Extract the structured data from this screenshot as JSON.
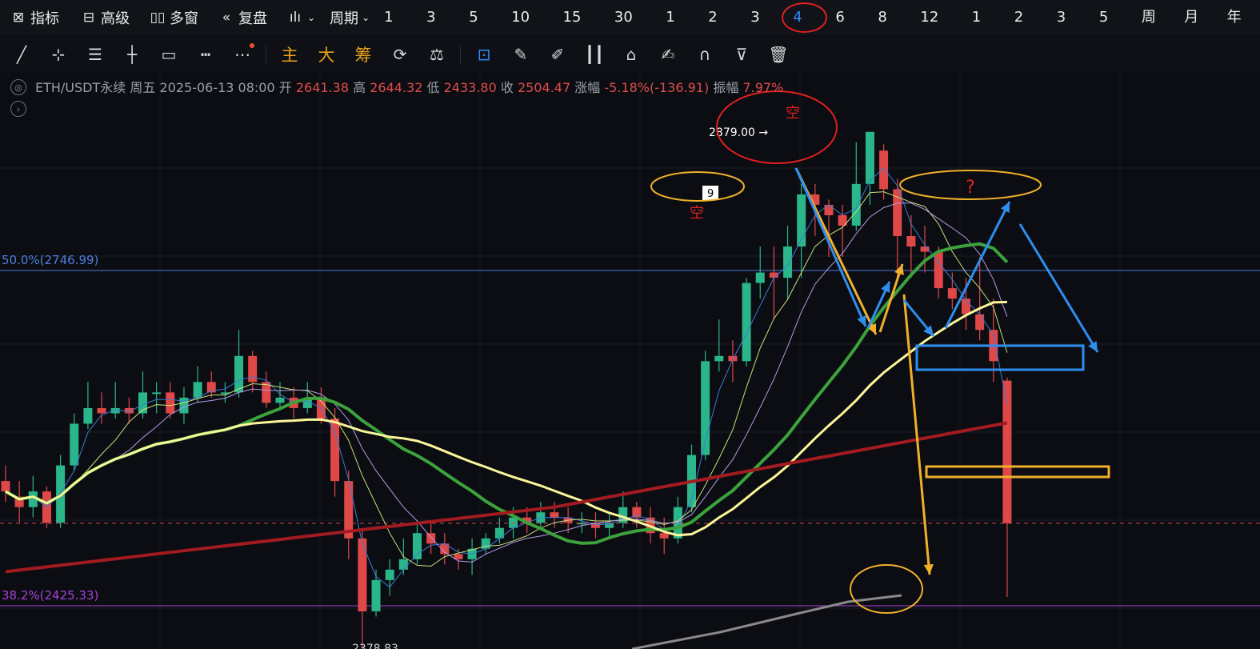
{
  "toolbar": {
    "indicators": "指标",
    "advanced": "高级",
    "multiwindow": "多窗",
    "replay": "复盘",
    "period_menu": "周期",
    "periods": [
      "1分",
      "3分",
      "5分",
      "10分",
      "15分",
      "30分",
      "1时",
      "2时",
      "3时",
      "4时",
      "6时",
      "8时",
      "12时",
      "1日",
      "2日",
      "3日",
      "5日",
      "周K",
      "月K",
      "年K"
    ],
    "active_period": "4时"
  },
  "drawtools": {
    "main": "主",
    "large": "大",
    "chips": "筹"
  },
  "info": {
    "symbol": "ETH/USDT永续",
    "weekday": "周五",
    "datetime": "2025-06-13 08:00",
    "open_label": "开",
    "open": "2641.38",
    "high_label": "高",
    "high": "2644.32",
    "low_label": "低",
    "low": "2433.80",
    "close_label": "收",
    "close": "2504.47",
    "change_label": "涨幅",
    "change": "-5.18%(-136.91)",
    "amp_label": "振幅",
    "amp": "7.97%"
  },
  "chart_data": {
    "type": "candlestick",
    "fib_levels": [
      {
        "label": "50.0%(2746.99)",
        "value": 2746.99,
        "color": "#4f7ddb"
      },
      {
        "label": "38.2%(2425.33)",
        "value": 2425.33,
        "color": "#a742d8"
      }
    ],
    "high_marker": "2879.00",
    "low_marker_partial": "2378.83",
    "annotations": {
      "short_1": "空",
      "short_2": "空",
      "question": "?",
      "td_count": "9"
    },
    "y_range": [
      2375,
      2930
    ],
    "candles": [
      [
        2545,
        2535,
        2560,
        2525
      ],
      [
        2530,
        2520,
        2545,
        2505
      ],
      [
        2520,
        2535,
        2550,
        2510
      ],
      [
        2535,
        2505,
        2540,
        2500
      ],
      [
        2505,
        2560,
        2570,
        2500
      ],
      [
        2560,
        2600,
        2610,
        2555
      ],
      [
        2600,
        2615,
        2640,
        2595
      ],
      [
        2615,
        2610,
        2630,
        2600
      ],
      [
        2610,
        2615,
        2640,
        2605
      ],
      [
        2615,
        2610,
        2625,
        2600
      ],
      [
        2610,
        2630,
        2650,
        2605
      ],
      [
        2630,
        2630,
        2640,
        2610
      ],
      [
        2630,
        2610,
        2640,
        2605
      ],
      [
        2610,
        2625,
        2635,
        2600
      ],
      [
        2625,
        2640,
        2655,
        2620
      ],
      [
        2640,
        2630,
        2650,
        2625
      ],
      [
        2630,
        2630,
        2640,
        2620
      ],
      [
        2630,
        2665,
        2690,
        2625
      ],
      [
        2665,
        2640,
        2670,
        2630
      ],
      [
        2640,
        2620,
        2650,
        2615
      ],
      [
        2620,
        2625,
        2640,
        2615
      ],
      [
        2625,
        2615,
        2635,
        2605
      ],
      [
        2615,
        2625,
        2640,
        2610
      ],
      [
        2625,
        2605,
        2635,
        2600
      ],
      [
        2605,
        2545,
        2615,
        2530
      ],
      [
        2545,
        2490,
        2555,
        2470
      ],
      [
        2490,
        2420,
        2500,
        2378.83
      ],
      [
        2420,
        2450,
        2460,
        2415
      ],
      [
        2450,
        2460,
        2470,
        2435
      ],
      [
        2460,
        2470,
        2490,
        2455
      ],
      [
        2470,
        2495,
        2505,
        2465
      ],
      [
        2495,
        2485,
        2505,
        2475
      ],
      [
        2485,
        2475,
        2495,
        2465
      ],
      [
        2475,
        2470,
        2480,
        2460
      ],
      [
        2470,
        2480,
        2490,
        2455
      ],
      [
        2480,
        2490,
        2495,
        2475
      ],
      [
        2490,
        2500,
        2510,
        2485
      ],
      [
        2500,
        2510,
        2520,
        2490
      ],
      [
        2510,
        2505,
        2520,
        2495
      ],
      [
        2505,
        2515,
        2525,
        2500
      ],
      [
        2515,
        2510,
        2525,
        2500
      ],
      [
        2510,
        2505,
        2520,
        2495
      ],
      [
        2505,
        2505,
        2515,
        2495
      ],
      [
        2505,
        2500,
        2515,
        2490
      ],
      [
        2500,
        2505,
        2515,
        2490
      ],
      [
        2505,
        2520,
        2535,
        2500
      ],
      [
        2520,
        2510,
        2525,
        2500
      ],
      [
        2510,
        2495,
        2520,
        2485
      ],
      [
        2495,
        2490,
        2510,
        2475
      ],
      [
        2490,
        2520,
        2530,
        2485
      ],
      [
        2520,
        2570,
        2580,
        2515
      ],
      [
        2570,
        2660,
        2670,
        2565
      ],
      [
        2660,
        2665,
        2700,
        2650
      ],
      [
        2665,
        2660,
        2680,
        2640
      ],
      [
        2660,
        2735,
        2740,
        2655
      ],
      [
        2735,
        2745,
        2770,
        2720
      ],
      [
        2745,
        2740,
        2770,
        2700
      ],
      [
        2740,
        2770,
        2790,
        2720
      ],
      [
        2770,
        2820,
        2830,
        2740
      ],
      [
        2820,
        2810,
        2830,
        2780
      ],
      [
        2810,
        2800,
        2815,
        2760
      ],
      [
        2800,
        2790,
        2810,
        2760
      ],
      [
        2790,
        2830,
        2870,
        2785
      ],
      [
        2830,
        2880,
        2879,
        2810
      ],
      [
        2862,
        2825,
        2868,
        2815
      ],
      [
        2825,
        2780,
        2835,
        2740
      ],
      [
        2780,
        2770,
        2800,
        2740
      ],
      [
        2770,
        2765,
        2790,
        2745
      ],
      [
        2765,
        2730,
        2770,
        2720
      ],
      [
        2730,
        2720,
        2745,
        2710
      ],
      [
        2720,
        2705,
        2740,
        2690
      ],
      [
        2705,
        2690,
        2760,
        2680
      ],
      [
        2690,
        2660,
        2720,
        2640
      ],
      [
        2641.38,
        2504.47,
        2644.32,
        2433.8
      ]
    ]
  }
}
